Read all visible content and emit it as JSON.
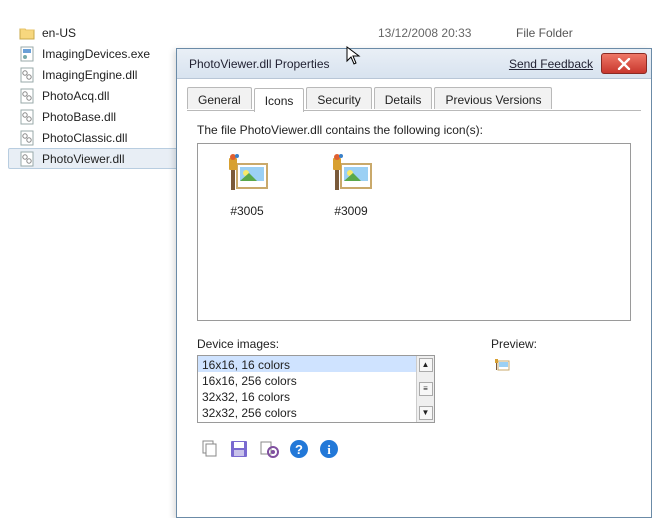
{
  "explorer": {
    "rows": [
      {
        "name": "en-US",
        "date": "13/12/2008 20:33",
        "type": "File Folder",
        "kind": "folder"
      },
      {
        "name": "ImagingDevices.exe",
        "kind": "exe"
      },
      {
        "name": "ImagingEngine.dll",
        "kind": "dll"
      },
      {
        "name": "PhotoAcq.dll",
        "kind": "dll"
      },
      {
        "name": "PhotoBase.dll",
        "kind": "dll"
      },
      {
        "name": "PhotoClassic.dll",
        "kind": "dll"
      },
      {
        "name": "PhotoViewer.dll",
        "kind": "dll",
        "selected": true
      }
    ]
  },
  "dialog": {
    "title": "PhotoViewer.dll Properties",
    "feedback": "Send Feedback",
    "tabs": [
      "General",
      "Icons",
      "Security",
      "Details",
      "Previous Versions"
    ],
    "active_tab": 1,
    "panel": {
      "heading": "The file PhotoViewer.dll contains the following icon(s):",
      "icons": [
        {
          "caption": "#3005"
        },
        {
          "caption": "#3009"
        }
      ],
      "device_label": "Device images:",
      "device_options": [
        "16x16, 16 colors",
        "16x16, 256 colors",
        "32x32, 16 colors",
        "32x32, 256 colors"
      ],
      "preview_label": "Preview:"
    },
    "toolbar": {
      "copy": "copy",
      "save": "save",
      "props": "properties",
      "help": "help",
      "info": "info"
    }
  }
}
